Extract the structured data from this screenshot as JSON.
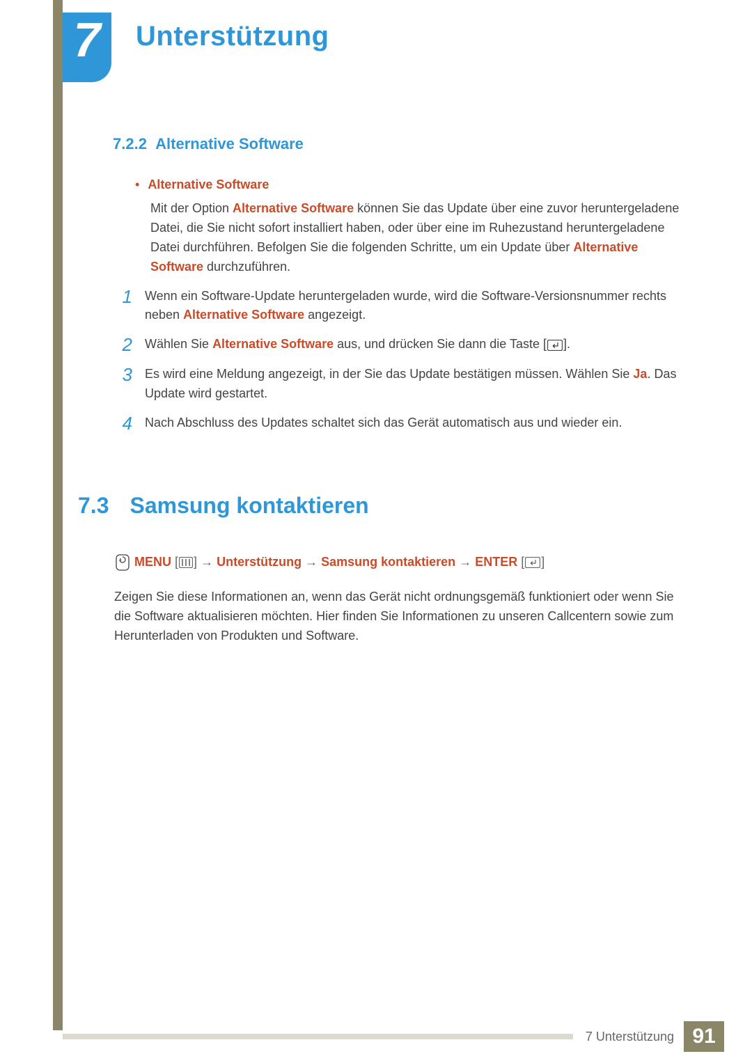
{
  "chapter": {
    "number": "7",
    "title": "Unterstützung"
  },
  "section722": {
    "number": "7.2.2",
    "title": "Alternative Software",
    "bullet_heading": "Alternative Software",
    "intro_before": "Mit der Option ",
    "intro_emph1": "Alternative Software",
    "intro_mid": " können Sie das Update über eine zuvor heruntergeladene Datei, die Sie nicht sofort installiert haben, oder über eine im Ruhezustand heruntergeladene Datei durchführen. Befolgen Sie die folgenden Schritte, um ein Update über ",
    "intro_emph2": "Alternative Software",
    "intro_after": " durchzuführen.",
    "steps": [
      {
        "num": "1",
        "pre": "Wenn ein Software-Update heruntergeladen wurde, wird die Software-Versionsnummer rechts neben ",
        "emph": "Alternative Software",
        "post": " angezeigt."
      },
      {
        "num": "2",
        "pre": "Wählen Sie ",
        "emph": "Alternative Software",
        "post": " aus, und drücken Sie dann die Taste [",
        "icon": true,
        "post2": "]."
      },
      {
        "num": "3",
        "pre": "Es wird eine Meldung angezeigt, in der Sie das Update bestätigen müssen. Wählen Sie ",
        "emph": "Ja",
        "post": ". Das Update wird gestartet."
      },
      {
        "num": "4",
        "pre": "Nach Abschluss des Updates schaltet sich das Gerät automatisch aus und wieder ein."
      }
    ]
  },
  "section73": {
    "number": "7.3",
    "title": "Samsung kontaktieren",
    "path": {
      "menu": "MENU",
      "arrow": "→",
      "p1": "Unterstützung",
      "p2": "Samsung kontaktieren",
      "enter": "ENTER"
    },
    "body": "Zeigen Sie diese Informationen an, wenn das Gerät nicht ordnungsgemäß funktioniert oder wenn Sie die Software aktualisieren möchten. Hier finden Sie Informationen zu unseren Callcentern sowie zum Herunterladen von Produkten und Software."
  },
  "footer": {
    "label": "7 Unterstützung",
    "page": "91"
  }
}
